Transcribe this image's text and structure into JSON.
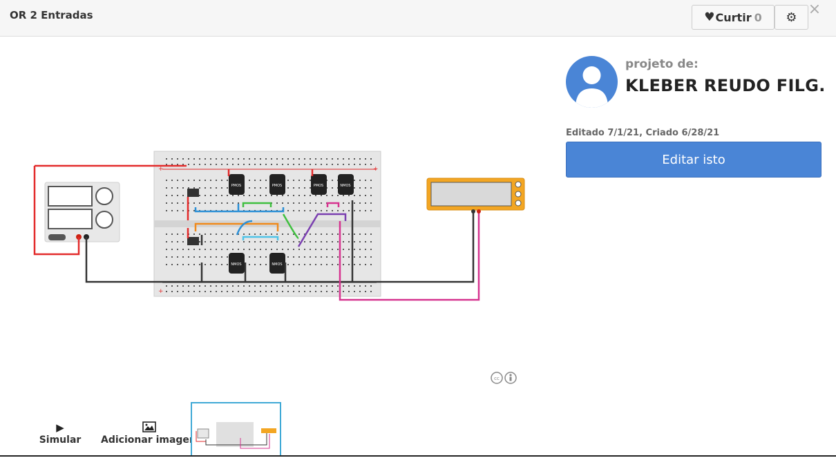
{
  "header": {
    "title": "OR 2 Entradas",
    "like_label": "Curtir",
    "like_count": "0",
    "like_icon": "heart-icon",
    "settings_icon": "gear-icon",
    "close_icon": "close-icon"
  },
  "circuit": {
    "chip_labels": [
      "PMOS",
      "PMOS",
      "PMOS",
      "NMOS",
      "NMOS",
      "NMOS"
    ],
    "breadboard_rail_symbol_plus": "+",
    "breadboard_rail_symbol_minus": "-",
    "wire_colors": {
      "red": "#e32b2b",
      "black": "#333333",
      "green": "#3fbf3f",
      "blue": "#2a8fd6",
      "orange": "#f08a1c",
      "purple": "#7a3fb0",
      "magenta": "#d6338f",
      "cyan": "#4fc3e8"
    }
  },
  "sidebar": {
    "by_label": "projeto de:",
    "author": "KLEBER REUDO FILG...",
    "dates": "Editado 7/1/21, Criado 6/28/21",
    "edit_button": "Editar isto",
    "accent": "#4a85d6"
  },
  "footer": {
    "simulate_label": "Simular",
    "simulate_icon": "play-icon",
    "add_image_label": "Adicionar imagem",
    "add_image_icon": "image-icon",
    "license_icon": "creative-commons-icon"
  }
}
